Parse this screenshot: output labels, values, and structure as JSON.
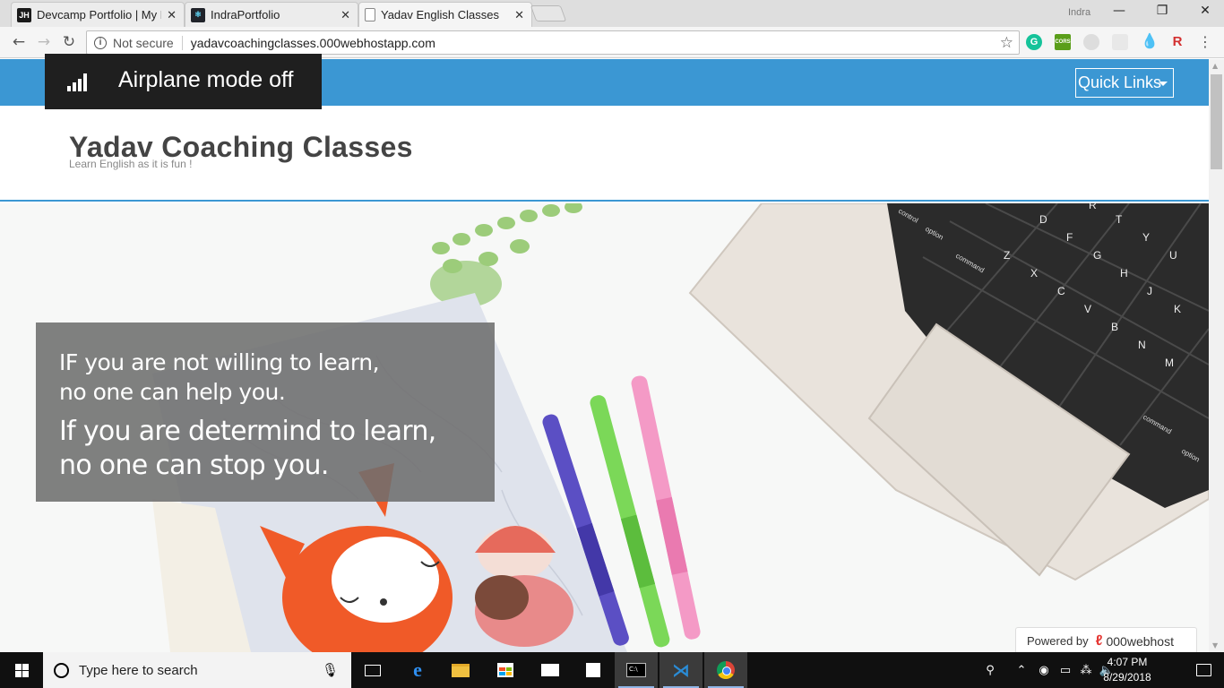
{
  "browser": {
    "tabs": [
      {
        "favicon": "JH",
        "title": "Devcamp Portfolio | My P",
        "active": false
      },
      {
        "favicon": "react-icon",
        "title": "IndraPortfolio",
        "active": false
      },
      {
        "favicon": "page-icon",
        "title": "Yadav English Classes",
        "active": true
      }
    ],
    "tab_close": "✕",
    "user": "Indra",
    "window_controls": {
      "minimize": "—",
      "maximize": "❐",
      "close": "✕"
    },
    "nav": {
      "back": "←",
      "forward": "→",
      "reload": "↻"
    },
    "security_label": "Not secure",
    "url": "yadavcoachingclasses.000webhostapp.com",
    "bookmark_star": "☆",
    "extensions": [
      "G",
      "CORS",
      "",
      "",
      "💧",
      "R"
    ],
    "menu": "⋮"
  },
  "page": {
    "quick_links_label": "Quick Links",
    "site_title": "Yadav Coaching Classes",
    "tagline": "Learn English as it is fun !",
    "quote": {
      "line1": "IF you are not willing to learn,",
      "line2": "no one can help you.",
      "line3": "If you are determind to learn,",
      "line4": "no one can stop you."
    },
    "powered_by": {
      "prefix": "Powered by",
      "brand": "000webhost"
    },
    "keyboard_keys": [
      "control",
      "option",
      "command",
      "Z",
      "X",
      "C",
      "V",
      "B",
      "N",
      "M",
      "D",
      "F",
      "G",
      "H",
      "J",
      "K",
      "R",
      "T",
      "Y",
      "U",
      "command",
      "option"
    ]
  },
  "toast": {
    "text": "Airplane mode off"
  },
  "taskbar": {
    "search_placeholder": "Type here to search",
    "time": "4:07 PM",
    "date": "8/29/2018"
  },
  "colors": {
    "accent": "#3b97d3",
    "title_text": "#444444",
    "taskbar": "#101010"
  }
}
